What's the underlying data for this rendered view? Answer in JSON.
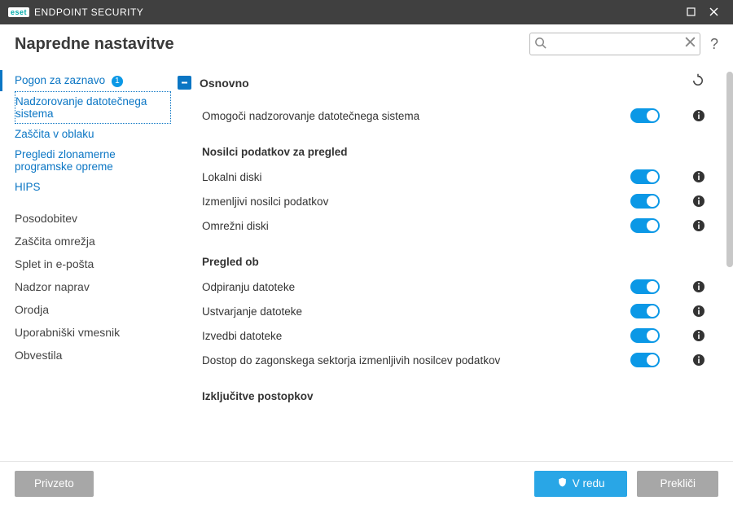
{
  "titlebar": {
    "brand_badge": "eset",
    "brand_text": "ENDPOINT SECURITY"
  },
  "header": {
    "title": "Napredne nastavitve",
    "search_placeholder": ""
  },
  "sidebar": {
    "detection": {
      "label": "Pogon za zaznavo",
      "badge": "1"
    },
    "subs": {
      "filesystem": "Nadzorovanje datotečnega sistema",
      "cloud": "Zaščita v oblaku",
      "malware": "Pregledi zlonamerne programske opreme",
      "hips": "HIPS"
    },
    "items": {
      "update": "Posodobitev",
      "network": "Zaščita omrežja",
      "webmail": "Splet in e-pošta",
      "devctrl": "Nadzor naprav",
      "tools": "Orodja",
      "ui": "Uporabniški vmesnik",
      "notifications": "Obvestila"
    }
  },
  "main": {
    "section_title": "Osnovno",
    "rows": {
      "enable_fs": "Omogoči nadzorovanje datotečnega sistema"
    },
    "media_heading": "Nosilci podatkov za pregled",
    "media": {
      "local": "Lokalni diski",
      "removable": "Izmenljivi nosilci podatkov",
      "network": "Omrežni diski"
    },
    "scanon_heading": "Pregled ob",
    "scanon": {
      "open": "Odpiranju datoteke",
      "create": "Ustvarjanje datoteke",
      "execute": "Izvedbi datoteke",
      "bootsector": "Dostop do zagonskega sektorja izmenljivih nosilcev podatkov"
    },
    "exclusions_heading": "Izključitve postopkov"
  },
  "footer": {
    "default": "Privzeto",
    "ok": "V redu",
    "cancel": "Prekliči"
  }
}
